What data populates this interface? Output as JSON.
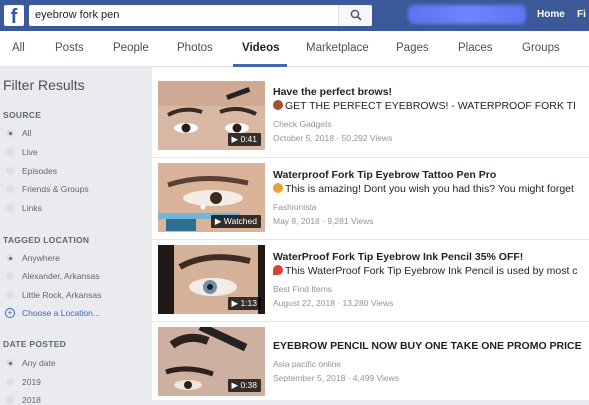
{
  "topbar": {
    "logo": "f",
    "search_query": "eyebrow fork pen",
    "home_label": "Home",
    "fi_label": "Fi"
  },
  "tabs": [
    "All",
    "Posts",
    "People",
    "Photos",
    "Videos",
    "Marketplace",
    "Pages",
    "Places",
    "Groups"
  ],
  "active_tab": "Videos",
  "sidebar": {
    "title": "Filter Results",
    "source": {
      "heading": "SOURCE",
      "options": [
        "All",
        "Live",
        "Episodes",
        "Friends & Groups",
        "Links"
      ],
      "selected": "All"
    },
    "tagged_location": {
      "heading": "TAGGED LOCATION",
      "options": [
        "Anywhere",
        "Alexander, Arkansas",
        "Little Rock, Arkansas"
      ],
      "selected": "Anywhere",
      "choose_label": "Choose a Location..."
    },
    "date_posted": {
      "heading": "DATE POSTED",
      "options": [
        "Any date",
        "2019",
        "2018"
      ],
      "selected": "Any date"
    }
  },
  "results": [
    {
      "title": "Have the perfect brows!",
      "description": "GET THE PERFECT EYEBROWS! - WATERPROOF FORK TI",
      "emoji": "brown-face-emoji",
      "source": "Check Gadgets",
      "date": "October 5, 2018",
      "views": "50,292 Views",
      "duration": "0:41"
    },
    {
      "title": "Waterproof Fork Tip Eyebrow Tattoo Pen Pro",
      "description": "This is amazing! Dont you wish you had this? You might forget",
      "emoji": "heart-eyes-emoji",
      "source": "Fashionista",
      "date": "May 8, 2018",
      "views": "9,281 Views",
      "duration": "Watched"
    },
    {
      "title": "WaterProof Fork Tip Eyebrow Ink Pencil 35% OFF!",
      "description": "This WaterProof Fork Tip Eyebrow Ink Pencil is used by most c",
      "emoji": "pin-emoji",
      "source": "Best Find Items",
      "date": "August 22, 2018",
      "views": "13,280 Views",
      "duration": "1:13"
    },
    {
      "title": "EYEBROW PENCIL NOW BUY ONE TAKE ONE PROMO PRICE",
      "description": "",
      "emoji": "",
      "source": "Asia pacific online",
      "date": "September 5, 2018",
      "views": "4,499 Views",
      "duration": "0:38"
    }
  ],
  "colors": {
    "brand": "#3b5998",
    "link": "#4267b2",
    "page_bg": "#e9ebee"
  }
}
